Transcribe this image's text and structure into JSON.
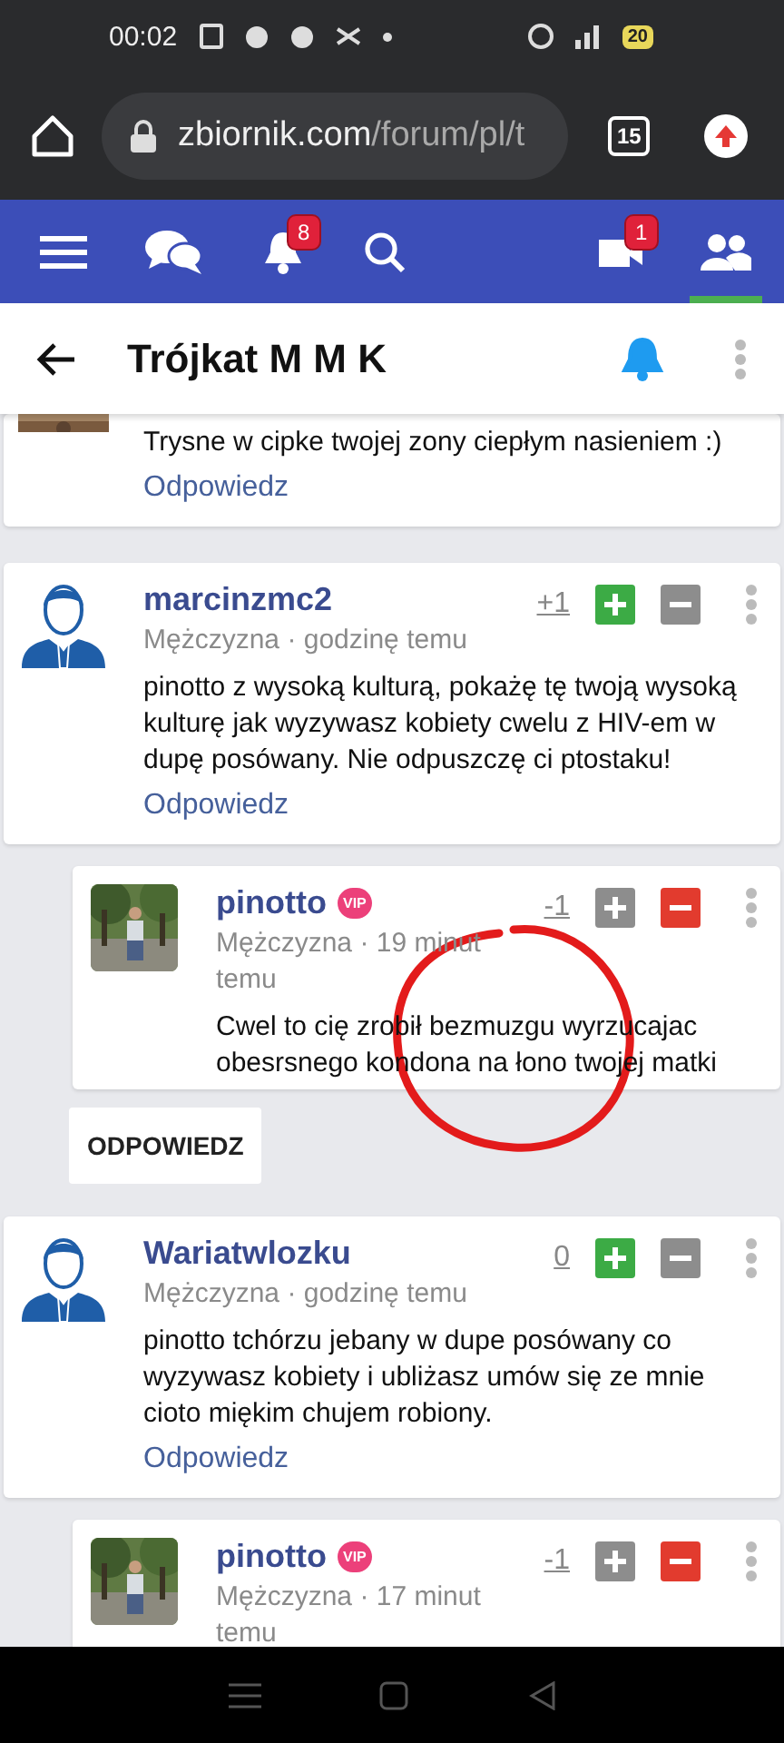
{
  "status_bar": {
    "time": "00:02",
    "battery": "20"
  },
  "browser": {
    "url_host": "zbiornik.com",
    "url_path": "/forum/pl/t",
    "tab_count": "15"
  },
  "nav": {
    "left": [
      {
        "kind": "menu",
        "selected": false
      },
      {
        "kind": "chat",
        "selected": false
      },
      {
        "kind": "bell",
        "badge": "8",
        "selected": false
      },
      {
        "kind": "search",
        "selected": false
      }
    ],
    "right": [
      {
        "kind": "video",
        "badge": "1",
        "selected": false
      },
      {
        "kind": "people",
        "selected": true
      }
    ]
  },
  "topic": {
    "title": "Trójkat M M K",
    "subscribed": true
  },
  "posts": [
    {
      "kind": "comment_tail",
      "text": "Trysne w cipke twojej zony ciepłym nasieniem :)",
      "reply_link": "Odpowiedz"
    },
    {
      "kind": "comment",
      "avatar": {
        "kind": "silhouette"
      },
      "author": "marcinzmc2",
      "vip": false,
      "meta": "Mężczyzna · godzinę temu",
      "score": "+1",
      "upvoted": true,
      "downvoted": false,
      "text": "pinotto z wysoką kulturą, pokażę tę twoją wysoką kulturę jak wyzywasz kobiety cwelu z HIV-em w dupę posówany. Nie odpuszczę ci ptostaku!",
      "reply_link": "Odpowiedz"
    },
    {
      "kind": "reply",
      "author": "pinotto",
      "vip": true,
      "vip_label": "VIP",
      "meta": "Mężczyzna · 19 minut temu",
      "score": "-1",
      "upvoted": false,
      "downvoted": true,
      "text": "Cwel to cię zrobił bezmuzgu wyrzucajac obesrsnego kondona na łono twojej matki"
    },
    {
      "kind": "reply_button",
      "label": "ODPOWIEDZ"
    },
    {
      "kind": "comment",
      "avatar": {
        "kind": "silhouette"
      },
      "author": "Wariatwlozku",
      "vip": false,
      "meta": "Mężczyzna · godzinę temu",
      "score": "0",
      "upvoted": true,
      "downvoted": false,
      "text": "pinotto tchórzu jebany w dupe posówany co wyzywasz kobiety i ubliżasz umów się ze mnie cioto miękim chujem robiony.",
      "reply_link": "Odpowiedz"
    },
    {
      "kind": "reply",
      "author": "pinotto",
      "vip": true,
      "vip_label": "VIP",
      "meta": "Mężczyzna · 17 minut temu",
      "score": "-1",
      "upvoted": false,
      "downvoted": true
    }
  ]
}
